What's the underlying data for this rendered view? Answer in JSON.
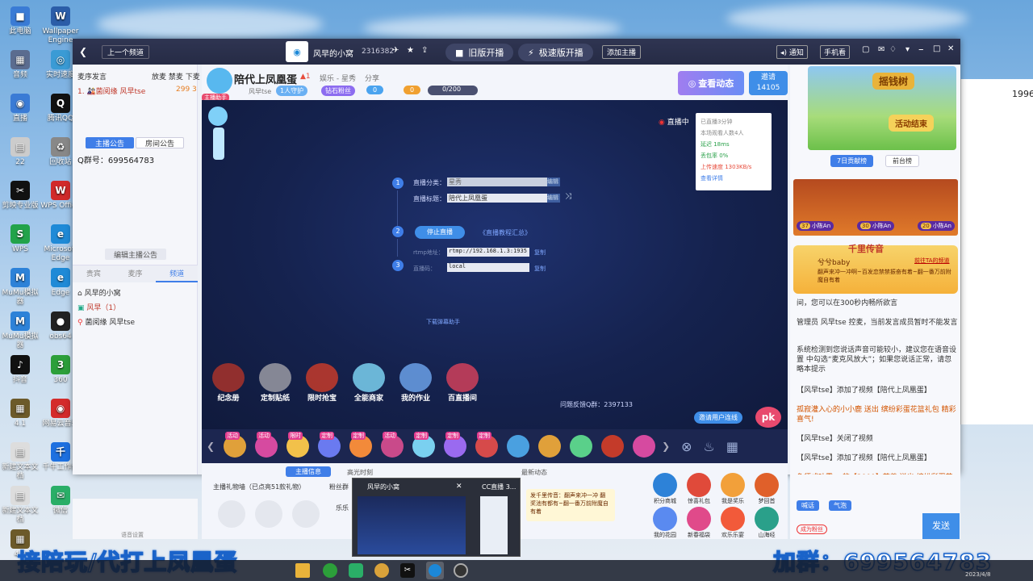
{
  "desktop_icons": [
    {
      "label": "此电脑",
      "glyph": "■",
      "color": "#3a7bd5"
    },
    {
      "label": "Wallpaper Engine",
      "glyph": "W",
      "color": "#2b5da8"
    },
    {
      "label": "音频",
      "glyph": "▦",
      "color": "#5b6c8f"
    },
    {
      "label": "实时速度",
      "glyph": "◎",
      "color": "#3a9bd5"
    },
    {
      "label": "直播",
      "glyph": "◉",
      "color": "#3a7bd5"
    },
    {
      "label": "腾讯QQ",
      "glyph": "Q",
      "color": "#111"
    },
    {
      "label": "22",
      "glyph": "▤",
      "color": "#cccccc"
    },
    {
      "label": "回收站",
      "glyph": "♻",
      "color": "#888"
    },
    {
      "label": "剪映专业版",
      "glyph": "✂",
      "color": "#111"
    },
    {
      "label": "WPS Office",
      "glyph": "W",
      "color": "#d12a2a"
    },
    {
      "label": "WPS",
      "glyph": "S",
      "color": "#22a34a"
    },
    {
      "label": "Microsoft Edge",
      "glyph": "e",
      "color": "#1f8ad7"
    },
    {
      "label": "MuMu模拟器",
      "glyph": "M",
      "color": "#2d82d8"
    },
    {
      "label": "Edge",
      "glyph": "e",
      "color": "#1f8ad7"
    },
    {
      "label": "MuMu模拟器",
      "glyph": "M",
      "color": "#2d82d8"
    },
    {
      "label": "obs64",
      "glyph": "●",
      "color": "#222"
    },
    {
      "label": "抖音",
      "glyph": "♪",
      "color": "#111"
    },
    {
      "label": "360",
      "glyph": "3",
      "color": "#2c9f3a"
    },
    {
      "label": "4.1",
      "glyph": "▦",
      "color": "#6c5a2a"
    },
    {
      "label": "网易云音乐",
      "glyph": "◉",
      "color": "#d42b2b"
    },
    {
      "label": "新建文本文档",
      "glyph": "▤",
      "color": "#ddd"
    },
    {
      "label": "千牛工作台",
      "glyph": "千",
      "color": "#1d70e0"
    },
    {
      "label": "新建文本文档",
      "glyph": "▤",
      "color": "#ddd"
    },
    {
      "label": "微信",
      "glyph": "✉",
      "color": "#2aae67"
    },
    {
      "label": "4.2",
      "glyph": "▦",
      "color": "#6c5a2a"
    }
  ],
  "titlebar": {
    "back": "上一个频道",
    "channel_name": "风早的小窝",
    "channel_id": "2316382",
    "old_start": "旧版开播",
    "fast_start": "极速版开播",
    "add_host": "添加主播",
    "notify": "通知",
    "mobile": "手机看"
  },
  "left": {
    "mode": "麦序发言",
    "mode_actions": "放麦 禁麦 下麦",
    "queue_user": "1. 🎎菌阅缘 风早tse",
    "queue_count": "299 3",
    "tab_notice": "主播公告",
    "tab_room_notice": "房间公告",
    "qq_group": "Q群号：699564783",
    "edit_notice": "编辑主播公告",
    "subtabs": [
      "贵宾",
      "麦序",
      "频道"
    ],
    "tree_root": "风早的小窝",
    "tree_sub": "风早（1）",
    "tree_user": "菌阅缘 风早tse"
  },
  "room": {
    "title": "陪代上凤凰蛋",
    "heat": "1",
    "category": "娱乐 - 星秀",
    "share": "分享",
    "host": "风早tse",
    "guard": "1人守护",
    "diamond_fans": "钻石粉丝",
    "fans_count": "0",
    "coins": "0",
    "progress": "0/200",
    "progress_fraction": 0,
    "view_dynamic": "查看动态",
    "invite": "邀请",
    "invite_count": "14105",
    "helper_badge": "主播助手"
  },
  "stage": {
    "live_label": "直播中",
    "stats": [
      "已直播3分钟",
      "本场观看人数4人",
      "延迟    18ms",
      "丢包率    0%",
      "上传速度 1303KB/s",
      "查看详情"
    ],
    "step1_cat_label": "直播分类：",
    "step1_cat_value": "星秀",
    "step1_title_label": "直播标题：",
    "step1_title_value": "陪代上凤凰蛋",
    "edit": "编辑",
    "stop_live": "停止直播",
    "tutorial": "《直播教程汇总》",
    "rtmp_label": "rtmp地址：",
    "rtmp_value": "rtmp://192.168.1.3:1935",
    "key_label": "直播码：",
    "key_value": "local",
    "copy": "复制",
    "download": "下载弹幕助手",
    "feedback": "问题反馈Q群：2397133",
    "mic_connect": "邀请用户连线",
    "bottom_icons": [
      "纪念册",
      "定制贴纸",
      "限时抢宝",
      "全能商家",
      "我的作业",
      "百直播间"
    ]
  },
  "gift_tags": [
    "活动",
    "活动",
    "限时",
    "定制",
    "定制",
    "活动",
    "定制",
    "定制",
    "定制"
  ],
  "below": {
    "tab_host_info": "主播信息",
    "tab_hi": "高光时刻",
    "tab_latest": "最新动态",
    "gift_wall": "主播礼物墙（已点亮51款礼物）",
    "fans": "粉丝群",
    "music": "乐乐",
    "voice_settings": "语音设置"
  },
  "right": {
    "banner": "摇钱树",
    "event_end": "活动结束",
    "tab_7day": "7日贡献榜",
    "tab_prev": "前台榜",
    "rank": [
      "小陈An",
      "小陈An",
      "小陈An"
    ],
    "rank_scores": [
      "37",
      "30",
      "20"
    ],
    "broadcast_title": "千里传音",
    "broadcast_user": "兮兮baby",
    "broadcast_link": "前往TA的频道",
    "broadcast_msg": "翻声来冲一冲啊~百发恋禁禁振奋有着~翻一番万前附魔自有着",
    "chat": [
      "间，您可以在300秒内畅所欲言",
      "管理员 风早tse 控麦，当前发言成员暂时不能发言",
      "系统检测到您说话声音可能较小，建议您在语音设置 中勾选“麦克风放大”；如果您说话正常，请忽略本提示",
      "【风早tse】添加了视频【陪代上凤凰蛋】",
      "孤寂灌入心的小小鹿 送出 缤纷彩蛋花篮礼包 精彩喜气!",
      "【风早tse】关闭了视频",
      "【风早tse】添加了视频【陪代上凤凰蛋】",
      "鱼师咸叶露。 的【2000】慈善 送出 缤纷彩蛋花篮礼包 精彩喜气!"
    ],
    "chat_btn": "喊话",
    "chat_btn2": "气泡",
    "send": "发送",
    "become_fan": "成为粉丝",
    "activities": [
      "积分商城",
      "惊喜礼包",
      "我是奖乐",
      "梦回首",
      "我的花园",
      "新春福袋",
      "欢乐乐宴",
      "山海经"
    ]
  },
  "taskbar_popup": {
    "window1": "风早的小窝",
    "window2": "CC直播 3...",
    "notice": "发千里传音：翻声来冲一冲 翻奖池有都有~翻一番万前附魔自 有着"
  },
  "overlay": {
    "left": "接陪玩/代打上凤凰蛋",
    "right": "加群：699564783"
  },
  "tray": {
    "date": "2023/4/8",
    "side_number": "1996"
  }
}
